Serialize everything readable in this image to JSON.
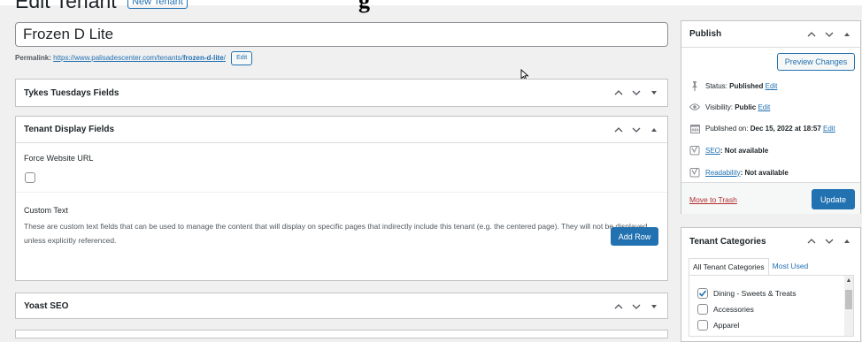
{
  "page": {
    "heading": "Edit Tenant",
    "new_button": "New Tenant",
    "overlay_title": "g"
  },
  "post": {
    "title": "Frozen D Lite",
    "permalink_label": "Permalink:",
    "permalink_base": "https://www.palisadescenter.com/tenants/",
    "permalink_slug": "frozen-d-lite",
    "permalink_tail": "/",
    "edit_button": "Edit"
  },
  "boxes": {
    "tykes": {
      "title": "Tykes Tuesdays Fields"
    },
    "display": {
      "title": "Tenant Display Fields",
      "force_url_label": "Force Website URL",
      "custom_text_label": "Custom Text",
      "custom_text_desc": "These are custom text fields that can be used to manage the content that will display on specific pages that indirectly include this tenant (e.g. the centered page). They will not be displayed unless explicitly referenced.",
      "add_row": "Add Row"
    },
    "yoast": {
      "title": "Yoast SEO"
    }
  },
  "publish": {
    "title": "Publish",
    "preview_button": "Preview Changes",
    "status_label": "Status:",
    "status_value": "Published",
    "visibility_label": "Visibility:",
    "visibility_value": "Public",
    "published_label": "Published on:",
    "published_value": "Dec 15, 2022 at 18:57",
    "edit_link": "Edit",
    "seo_link": "SEO",
    "seo_value": ": Not available",
    "readability_link": "Readability",
    "readability_value": ": Not available",
    "trash_link": "Move to Trash",
    "update_button": "Update"
  },
  "categories": {
    "title": "Tenant Categories",
    "tab_all": "All Tenant Categories",
    "tab_most_used": "Most Used",
    "items": [
      {
        "label": "Dining - Sweets & Treats",
        "checked": true
      },
      {
        "label": "Accessories",
        "checked": false
      },
      {
        "label": "Apparel",
        "checked": false
      }
    ]
  },
  "icons": {
    "up": "chevron-up-icon",
    "down": "chevron-down-icon",
    "toggle": "triangle-toggle-icon",
    "status": "pin-icon",
    "visibility": "eye-icon",
    "calendar": "calendar-icon",
    "yoast": "yoast-icon"
  },
  "colors": {
    "accent": "#2271b1",
    "danger": "#b32d2e",
    "background": "#f0f0f1"
  }
}
